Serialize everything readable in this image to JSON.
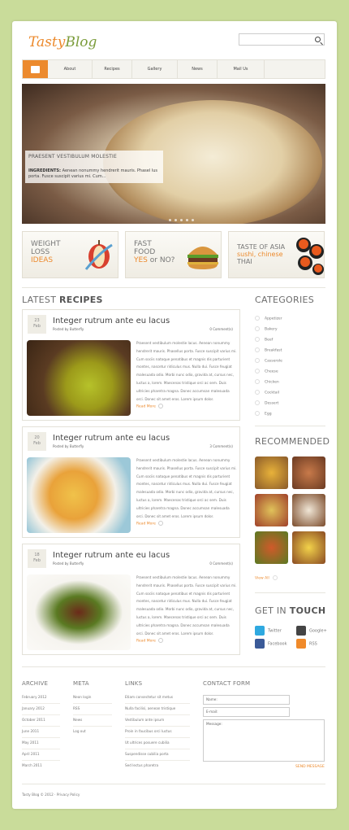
{
  "logo": {
    "part1": "Tasty",
    "part2": "Blog"
  },
  "search": {
    "placeholder": ""
  },
  "nav": {
    "items": [
      "About",
      "Recipes",
      "Gallery",
      "News",
      "Mail Us"
    ]
  },
  "slider": {
    "title": "PRAESENT VESTIBULUM MOLESTIE",
    "ingredients_label": "INGREDIENTS:",
    "ingredients_text": "Aenean nonummy hendrerit mauris. Phasel lus porta. Fusce suscipit varius mi. Cum..."
  },
  "promos": [
    {
      "line1": "WEIGHT",
      "line2": "LOSS",
      "line3": "IDEAS"
    },
    {
      "line1": "FAST",
      "line2": "FOOD",
      "line3a": "YES",
      "line3b": " or NO?"
    },
    {
      "line1": "TASTE OF ASIA",
      "line2": "sushi, chinese",
      "line3": "THAI"
    }
  ],
  "latest": {
    "heading_light": "LATEST ",
    "heading_bold": "RECIPES"
  },
  "posts": [
    {
      "day": "23",
      "month": "Feb",
      "title": "Integer rutrum ante eu lacus",
      "author": "Posted by Butterfly",
      "comments": "0 Comment(s)",
      "body": "Praesent vestibulum molestie lacus. Aenean nonummy hendrerit mauris. Phasellus porta. Fusce suscipit varius mi. Cum sociis natoque penatibus et magnis dis parturient montes, nascetur ridiculus mus. Nulla dui. Fusce feugiat malesuada odio. Morbi nunc odio, gravida at, cursus nec, luctus a, lorem. Maecenas tristique orci ac sem. Duis ultricies pharetra magna. Donec accumsan malesuada orci. Donec sit amet eros. Lorem ipsum dolor.",
      "more": "Read More"
    },
    {
      "day": "20",
      "month": "Feb",
      "title": "Integer rutrum ante eu lacus",
      "author": "Posted by Butterfly",
      "comments": "3 Comment(s)",
      "body": "Praesent vestibulum molestie lacus. Aenean nonummy hendrerit mauris. Phasellus porta. Fusce suscipit varius mi. Cum sociis natoque penatibus et magnis dis parturient montes, nascetur ridiculus mus. Nulla dui. Fusce feugiat malesuada odio. Morbi nunc odio, gravida at, cursus nec, luctus a, lorem. Maecenas tristique orci ac sem. Duis ultricies pharetra magna. Donec accumsan malesuada orci. Donec sit amet eros. Lorem ipsum dolor.",
      "more": "Read More"
    },
    {
      "day": "18",
      "month": "Feb",
      "title": "Integer rutrum ante eu lacus",
      "author": "Posted by Butterfly",
      "comments": "0 Comment(s)",
      "body": "Praesent vestibulum molestie lacus. Aenean nonummy hendrerit mauris. Phasellus porta. Fusce suscipit varius mi. Cum sociis natoque penatibus et magnis dis parturient montes, nascetur ridiculus mus. Nulla dui. Fusce feugiat malesuada odio. Morbi nunc odio, gravida at, cursus nec, luctus a, lorem. Maecenas tristique orci ac sem. Duis ultricies pharetra magna. Donec accumsan malesuada orci. Donec sit amet eros. Lorem ipsum dolor.",
      "more": "Read More"
    }
  ],
  "categories": {
    "heading": "CATEGORIES",
    "items": [
      "Appetizer",
      "Bakery",
      "Beef",
      "Breakfast",
      "Casserole",
      "Cheese",
      "Chicken",
      "Cocktail",
      "Dessert",
      "Egg"
    ]
  },
  "recommended": {
    "heading": "RECOMMENDED",
    "view_all": "View All"
  },
  "touch": {
    "heading_light": "GET IN ",
    "heading_bold": "TOUCH",
    "items": [
      "Twitter",
      "Google+",
      "Facebook",
      "RSS"
    ]
  },
  "footer": {
    "archive": {
      "heading": "ARCHIVE",
      "items": [
        "February 2012",
        "January 2012",
        "October 2011",
        "June 2011",
        "May 2011",
        "April 2011",
        "March 2011"
      ]
    },
    "meta": {
      "heading": "META",
      "items": [
        "Neon login",
        "RSS",
        "News",
        "Log out"
      ]
    },
    "links": {
      "heading": "LINKS",
      "items": [
        "Etiam consectetur sit metus",
        "Nulla facilisi, aenean tristique",
        "Vestibulum ante ipsum",
        "Proin in faucibus orci luctus",
        "Ut ultrices posuere cubilia",
        "Suspendisse cubilia porta",
        "Sed lectus pharetra"
      ]
    },
    "contact": {
      "heading": "CONTACT FORM",
      "name": "Name:",
      "email": "E-mail:",
      "message": "Message:",
      "send": "SEND MESSAGE"
    }
  },
  "copyright": "Tasty Blog © 2012 · Privacy Policy",
  "colors": {
    "accent": "#ec8a2d",
    "background": "#c9dc9a",
    "brand_green": "#7b9c3b"
  }
}
